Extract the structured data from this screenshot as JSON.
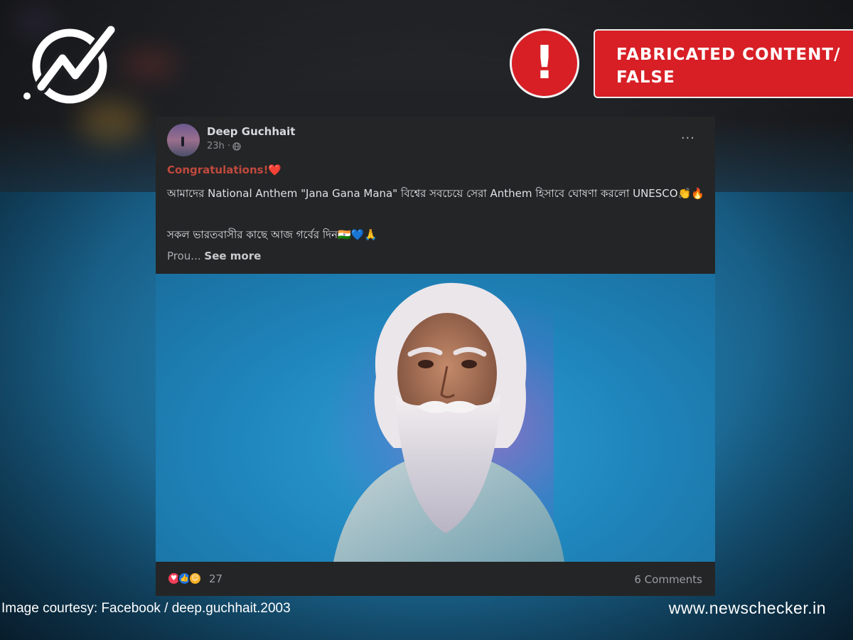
{
  "verdict": {
    "icon": "exclamation-icon",
    "line1": "FABRICATED CONTENT/",
    "line2": "FALSE",
    "color": "#d81f26"
  },
  "logo": {
    "icon": "newschecker-logo-icon"
  },
  "post": {
    "author": "Deep Guchhait",
    "time": "23h ·",
    "privacy_icon": "globe-icon",
    "more_icon": "more-options-icon",
    "more_label": "···",
    "congrats": "Congratulations!❤️",
    "line1": "আমাদের National Anthem \"Jana Gana Mana\" বিশ্বের সবচেয়ে সেরা Anthem হিসাবে ঘোষণা করলো UNESCO👏🔥",
    "line2": "সকল ভারতবাসীর কাছে আজ গর্বের দিন🇮🇳💙🙏",
    "truncated": "Prou...",
    "see_more": "See more"
  },
  "footer": {
    "reaction_icons": [
      "love-icon",
      "like-icon",
      "care-icon"
    ],
    "reaction_count": "27",
    "comments": "6 Comments"
  },
  "captions": {
    "courtesy": "Image courtesy:  Facebook / deep.guchhait.2003",
    "site": "www.newschecker.in"
  }
}
